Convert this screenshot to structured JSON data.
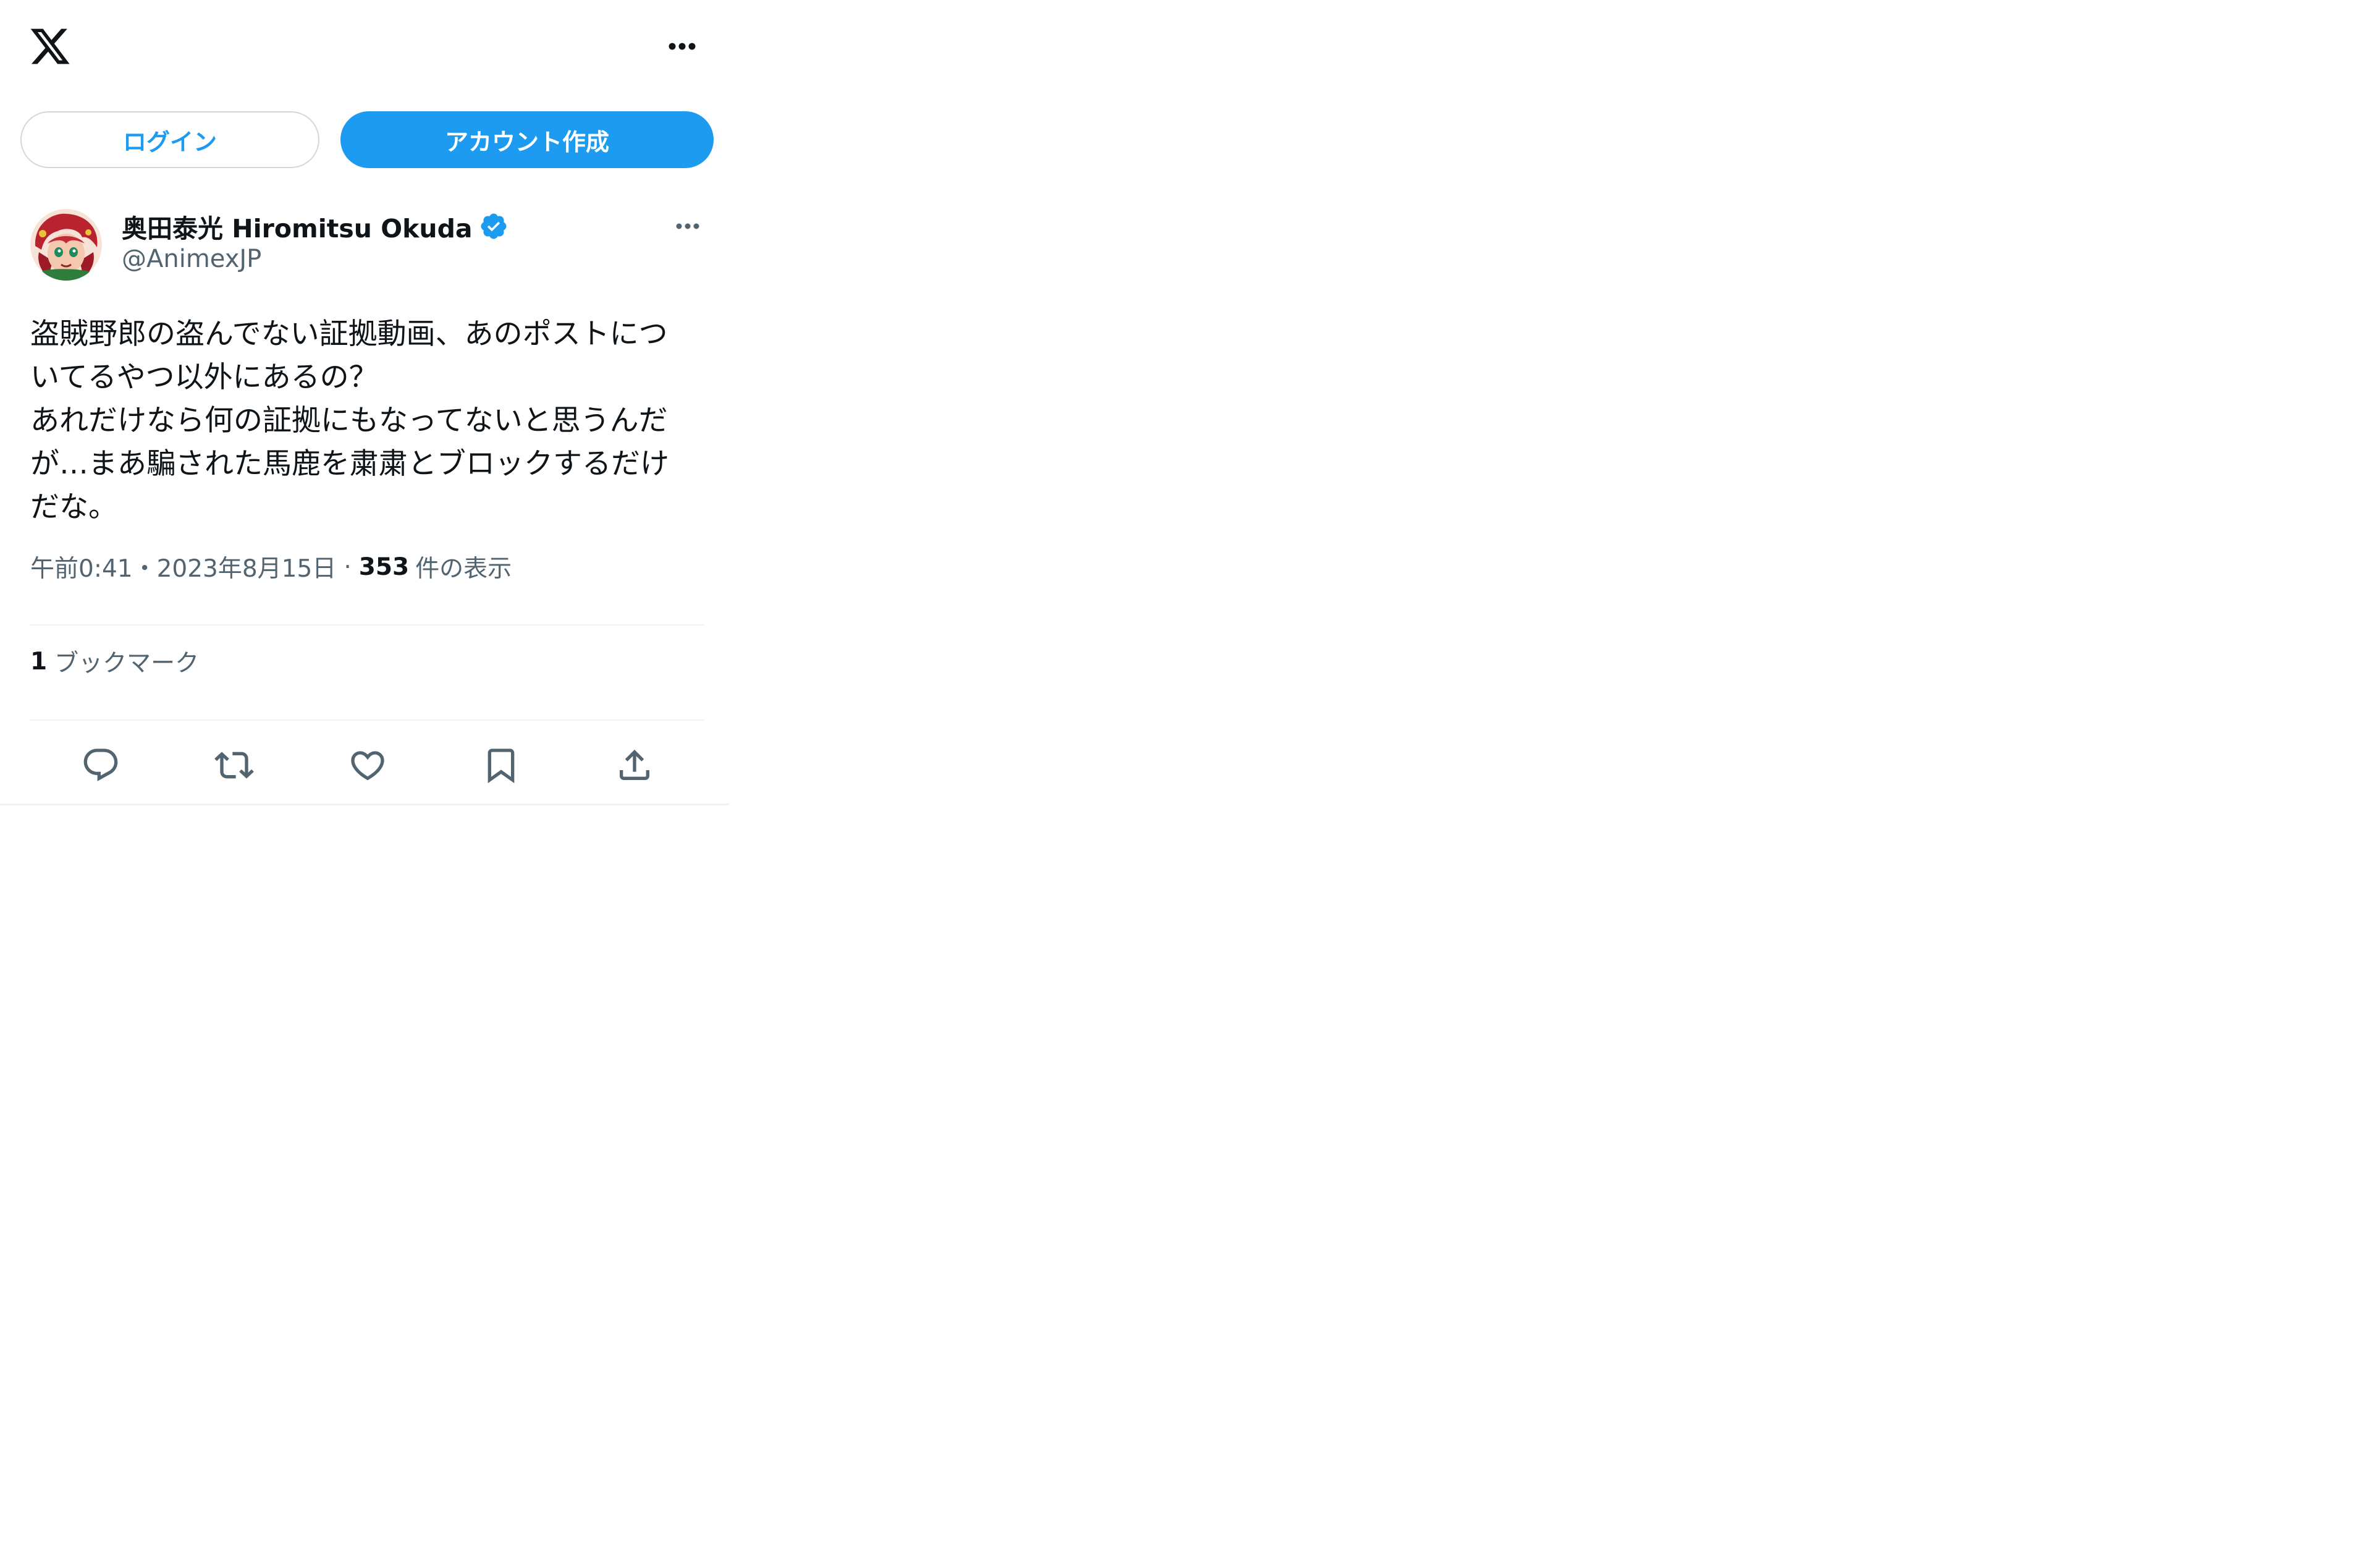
{
  "header": {
    "logo_icon": "x-logo-icon",
    "more_icon": "more-horizontal-icon"
  },
  "auth": {
    "login_label": "ログイン",
    "signup_label": "アカウント作成"
  },
  "tweet": {
    "author_name": "奥田泰光 Hiromitsu Okuda",
    "author_handle": "@AnimexJP",
    "verified": true,
    "text": "盗賊野郎の盗んでない証拠動画、あのポストにつ\nいてるやつ以外にあるの？\nあれだけなら何の証拠にもなってないと思うんだ\nが…まあ騙された馬鹿を粛粛とブロックするだけ\nだな。",
    "time": "午前0:41",
    "date": "2023年8月15日",
    "separator": "·",
    "dot": "・",
    "views_count": "353",
    "views_label": "件の表示",
    "bookmarks_count": "1",
    "bookmarks_label": "ブックマーク"
  },
  "actions": {
    "reply_icon": "reply-icon",
    "retweet_icon": "retweet-icon",
    "like_icon": "heart-icon",
    "bookmark_icon": "bookmark-icon",
    "share_icon": "share-icon"
  },
  "colors": {
    "accent": "#1d9bf0",
    "text_primary": "#0f1419",
    "text_secondary": "#536471",
    "border": "#cfd9de",
    "divider": "#eff3f4"
  }
}
